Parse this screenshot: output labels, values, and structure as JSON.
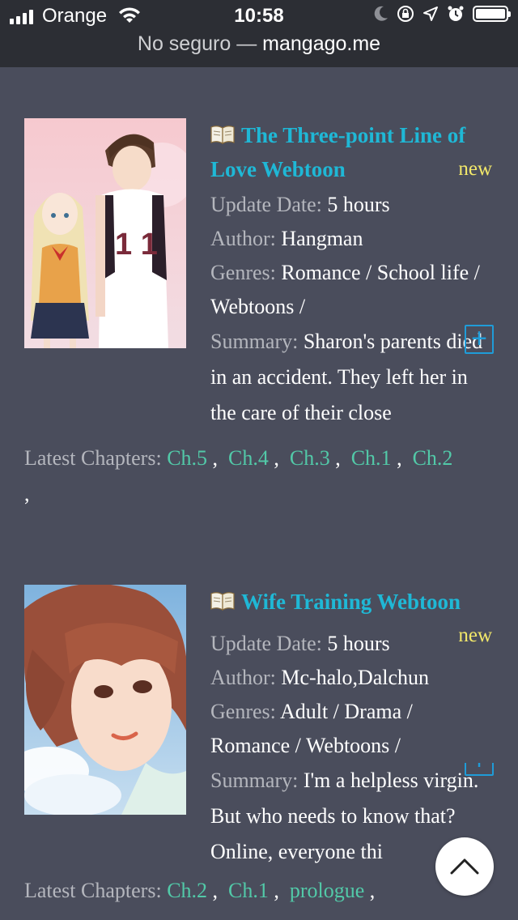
{
  "status_bar": {
    "carrier": "Orange",
    "time": "10:58"
  },
  "address_bar": {
    "security": "No seguro —",
    "host": "mangago.me"
  },
  "labels": {
    "update_date": "Update Date:",
    "author": "Author:",
    "genres": "Genres:",
    "summary": "Summary:",
    "latest_chapters": "Latest Chapters:",
    "new_badge": "new",
    "plus": "+"
  },
  "entries": [
    {
      "title": "The Three-point Line of Love Webtoon",
      "update_date": "5 hours",
      "author": "Hangman",
      "genres": "Romance / School life / Webtoons /",
      "summary": "Sharon's parents died in an accident. They left her in the care of their close",
      "chapters": [
        "Ch.5",
        "Ch.4",
        "Ch.3",
        "Ch.1",
        "Ch.2"
      ]
    },
    {
      "title": "Wife Training Webtoon",
      "update_date": "5 hours",
      "author": "Mc-halo,Dalchun",
      "genres": "Adult / Drama / Romance / Webtoons /",
      "summary": "I'm a helpless virgin. But who needs to know that? Online, everyone thi",
      "chapters": [
        "Ch.2",
        "Ch.1",
        "prologue"
      ]
    }
  ],
  "icons": {
    "book": "open-book-icon",
    "plus": "plus-icon",
    "scroll_top": "chevron-up-icon"
  }
}
